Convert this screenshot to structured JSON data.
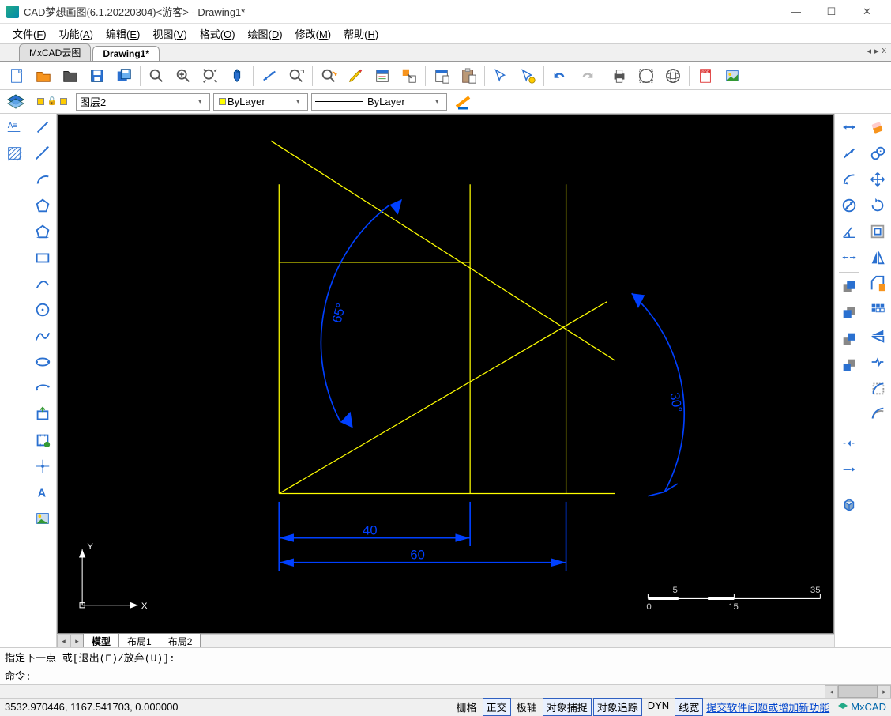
{
  "titlebar": {
    "text": "CAD梦想画图(6.1.20220304)<游客> - Drawing1*"
  },
  "menubar": [
    {
      "label": "文件",
      "key": "F"
    },
    {
      "label": "功能",
      "key": "A"
    },
    {
      "label": "编辑",
      "key": "E"
    },
    {
      "label": "视图",
      "key": "V"
    },
    {
      "label": "格式",
      "key": "O"
    },
    {
      "label": "绘图",
      "key": "D"
    },
    {
      "label": "修改",
      "key": "M"
    },
    {
      "label": "帮助",
      "key": "H"
    }
  ],
  "tabs": [
    {
      "label": "MxCAD云图",
      "active": false
    },
    {
      "label": "Drawing1*",
      "active": true
    }
  ],
  "toolbar_main": [
    "new",
    "open",
    "folder",
    "save",
    "saveas",
    "|",
    "zoom-search",
    "zoom-in",
    "zoom-ext",
    "pan",
    "|",
    "dimension",
    "zoom-win",
    "|",
    "zoom-prev",
    "pencil",
    "properties",
    "match",
    "|",
    "copyclip",
    "pasteclip",
    "|",
    "select",
    "select-filter",
    "|",
    "undo",
    "redo",
    "|",
    "print",
    "web",
    "globe",
    "|",
    "pdf",
    "image"
  ],
  "layerbar": {
    "layer_icon": "layers-icon",
    "state_icons": "layer-state-icons",
    "layer_combo": "图层2",
    "color_combo": "ByLayer",
    "linetype_combo": "ByLayer",
    "lineweight_icon": "lineweight-icon"
  },
  "left_toolbars": {
    "col1": [
      "multiline-text",
      "hatch"
    ],
    "col2": [
      "line",
      "xline",
      "arc",
      "polygon",
      "polygon2",
      "rectangle",
      "arc3p",
      "circle",
      "spline",
      "ellipse",
      "ellipse-arc",
      "block-insert",
      "make-block",
      "point",
      "mtext",
      "image-insert"
    ]
  },
  "right_toolbars": {
    "col1": [
      "dim-linear",
      "dim-aligned",
      "dim-arc",
      "dim-diameter",
      "dim-angular",
      "dim-continue",
      "|",
      "copy-front",
      "copy-back",
      "bring-front",
      "send-back",
      "",
      "",
      "",
      "",
      "",
      "",
      "trim-tool",
      "extend-tool",
      "",
      "cube"
    ],
    "col2": [
      "erase",
      "copy",
      "move",
      "rotate",
      "offset",
      "mirror-v",
      "chamfer",
      "array",
      "mirror-h",
      "break",
      "fillet",
      "stretch"
    ]
  },
  "drawing": {
    "dims": {
      "d1": "40",
      "d2": "60",
      "a1": "65°",
      "a2": "30°"
    },
    "axes": {
      "x": "X",
      "y": "Y"
    },
    "scale": {
      "l1": "0",
      "l2": "5",
      "l3": "15",
      "l4": "35"
    }
  },
  "layout_tabs": [
    "模型",
    "布局1",
    "布局2"
  ],
  "command": {
    "line1": "指定下一点 或[退出(E)/放弃(U)]:",
    "line2": "命令:"
  },
  "statusbar": {
    "coords": "3532.970446, 1167.541703, 0.000000",
    "toggles": [
      {
        "label": "栅格",
        "active": false
      },
      {
        "label": "正交",
        "active": true
      },
      {
        "label": "极轴",
        "active": false
      },
      {
        "label": "对象捕捉",
        "active": true
      },
      {
        "label": "对象追踪",
        "active": true
      },
      {
        "label": "DYN",
        "active": false
      },
      {
        "label": "线宽",
        "active": true
      }
    ],
    "link": "提交软件问题或增加新功能",
    "brand": "MxCAD"
  }
}
